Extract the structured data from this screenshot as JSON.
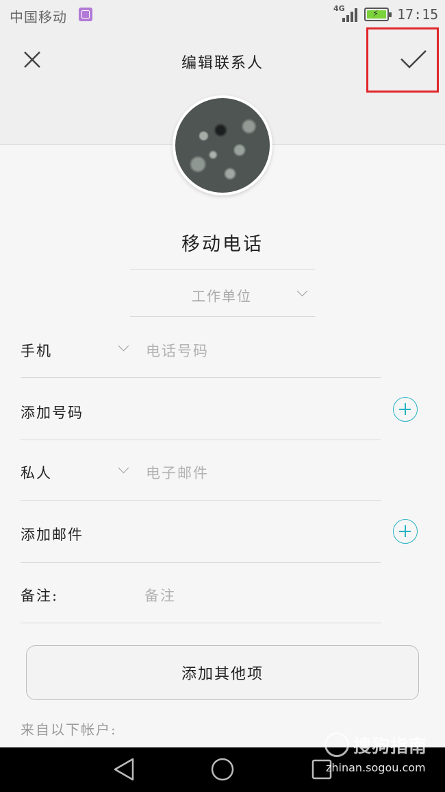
{
  "status_bar": {
    "carrier": "中国移动",
    "network": "4G",
    "time": "17:15",
    "notification_icon": "gallery-icon",
    "signal_icon": "signal-bars-icon",
    "battery_icon": "battery-charging-icon",
    "battery_color": "#7bd23a"
  },
  "header": {
    "title": "编辑联系人",
    "close_icon": "close-icon",
    "confirm_icon": "checkmark-icon",
    "highlight_color": "#e0262b"
  },
  "contact": {
    "avatar": "contact-photo",
    "name": "移动电话",
    "company_placeholder": "工作单位"
  },
  "fields": {
    "phone": {
      "label": "手机",
      "placeholder": "电话号码"
    },
    "add_phone": {
      "label": "添加号码"
    },
    "email": {
      "label": "私人",
      "placeholder": "电子邮件"
    },
    "add_email": {
      "label": "添加邮件"
    },
    "note": {
      "label": "备注:",
      "placeholder": "备注"
    }
  },
  "add_other_button": "添加其他项",
  "accounts_label": "来自以下帐户:",
  "accent_color": "#27b3c4",
  "watermark": {
    "text": "搜狗指南",
    "url": "zhinan.sogou.com"
  },
  "nav_bar": {
    "back_icon": "back-triangle-icon",
    "home_icon": "home-circle-icon",
    "recent_icon": "recent-square-icon"
  }
}
